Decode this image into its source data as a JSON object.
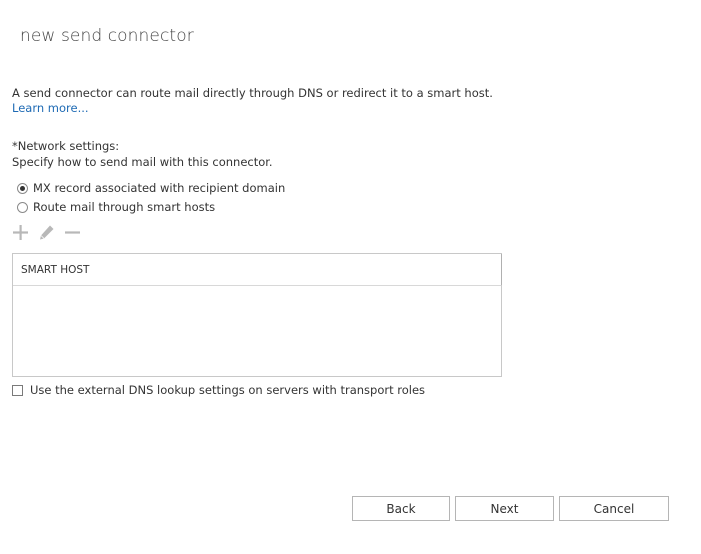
{
  "dialog": {
    "title": "new send connector",
    "intro_text": "A send connector can route mail directly through DNS or redirect it to a smart host. ",
    "learn_more_link": "Learn more..."
  },
  "network": {
    "label": "*Network settings:",
    "description": "Specify how to send mail with this connector.",
    "options": [
      {
        "label": "MX record associated with recipient domain",
        "selected": true
      },
      {
        "label": "Route mail through smart hosts",
        "selected": false
      }
    ]
  },
  "toolbar": {
    "icons": [
      "add-icon",
      "edit-icon",
      "remove-icon"
    ],
    "icon_color": "#b8b8b8"
  },
  "smart_hosts_table": {
    "columns": [
      "SMART HOST"
    ],
    "rows": []
  },
  "dns_option": {
    "label": "Use the external DNS lookup settings on servers with transport roles",
    "checked": false
  },
  "buttons": {
    "back": "Back",
    "next": "Next",
    "cancel": "Cancel"
  },
  "colors": {
    "link": "#1e6ab4",
    "text": "#333333"
  }
}
